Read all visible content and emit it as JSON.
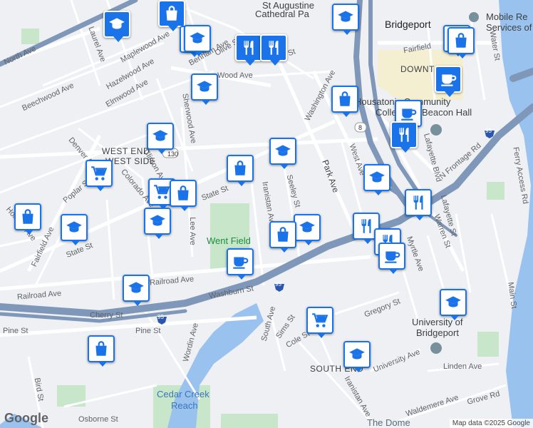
{
  "labels": {
    "north_ave": "North Ave",
    "laurel_ave": "Laurel Ave",
    "maplewood_ave": "Maplewood Ave",
    "benham_ave": "Benham Ave",
    "olive_st": "Olive St",
    "vine_st": "Vine St",
    "hazelwood_ave": "Hazelwood Ave",
    "beechwood_ave": "Beechwood Ave",
    "elmwood_ave": "Elmwood Ave",
    "wood_ave": "Wood Ave",
    "sherwood_ave": "Sherwood Ave",
    "washington_ave": "Washington Ave",
    "west_end": "WEST END",
    "west_side": "WEST SIDE",
    "denver_ave": "Denver Ave",
    "poplar_st": "Poplar St",
    "colorado_ave": "Colorado Ave",
    "clinton_ave": "Clinton Ave",
    "state_st": "State St",
    "state_st2": "State St",
    "iranistan_ave": "Iranistan Ave",
    "seeley_st": "Seeley St",
    "park_ave": "Park Ave",
    "west_ave": "West Ave",
    "went_field": "Went Field",
    "lee_ave": "Lee Ave",
    "fairfield_ave": "Fairfield Ave",
    "fairfield_ave2": "Fairfield Ave",
    "holland_ave": "Holland Ave",
    "railroad_ave": "Railroad Ave",
    "washburn_st": "Washburn St",
    "cherry_st": "Cherry St",
    "pine_st": "Pine St",
    "pine_st2": "Pine St",
    "wordin_ave": "Wordin Ave",
    "south_ave": "South Ave",
    "sims_st": "Sims St",
    "cole_st": "Cole St",
    "gregory_st": "Gregory St",
    "south_end": "SOUTH END",
    "university_ave": "University Ave",
    "iranistan_ave2": "Iranistan Ave",
    "linden_ave": "Linden Ave",
    "waldemere_ave": "Waldemere Ave",
    "grove_rd": "Grove Rd",
    "bird_st": "Bird St",
    "osborne_st": "Osborne St",
    "cedar_creek": "Cedar Creek",
    "reach": "Reach",
    "the_dome": "The Dome",
    "st_augustine": "St Augustine",
    "cathedral": "Cathedral Pa",
    "bridgeport": "Bridgeport",
    "mobile_rescue": "Mobile Re",
    "services_of": "Services of",
    "downtown": "DOWNT",
    "housatonic": "Housatonic Community",
    "college": "College",
    "beacon_hall": "Beacon Hall",
    "lafayette_blvd": "Lafayette Blvd",
    "n_frontage_rd": "N Frontage Rd",
    "ferry_access_rd": "Ferry Access Rd",
    "water_st": "Water St",
    "main_st": "Main St",
    "myrtle_ave": "Myrtle Ave",
    "warren_st": "Warren St",
    "lafayette_st": "Lafayette St",
    "university_of": "University of",
    "bridgeport2": "Bridgeport",
    "route_130": "130",
    "route_8": "8",
    "i95_a": "95",
    "i95_b": "95",
    "i95_c": "95",
    "fairfield_downtown": "Fairfield",
    "google": "Google",
    "map_data": "Map data ©2025 Google"
  },
  "pins": [
    {
      "id": "pin-1",
      "type": "school",
      "style": "dark"
    },
    {
      "id": "pin-2",
      "type": "shopping",
      "style": "dark"
    },
    {
      "id": "pin-3",
      "type": "restaurant",
      "style": "dark"
    },
    {
      "id": "pin-4",
      "type": "restaurant",
      "style": "dark"
    },
    {
      "id": "pin-5",
      "type": "school",
      "style": "light"
    },
    {
      "id": "pin-6",
      "type": "school",
      "style": "light"
    },
    {
      "id": "pin-7",
      "type": "shopping",
      "style": "light"
    },
    {
      "id": "pin-8",
      "type": "shopping",
      "style": "light"
    },
    {
      "id": "pin-9",
      "type": "cafe",
      "style": "dark"
    },
    {
      "id": "pin-10",
      "type": "cafe",
      "style": "light"
    },
    {
      "id": "pin-11",
      "type": "restaurant",
      "style": "dark"
    },
    {
      "id": "pin-12",
      "type": "school",
      "style": "light"
    },
    {
      "id": "pin-13",
      "type": "shopping",
      "style": "light"
    },
    {
      "id": "pin-14",
      "type": "school",
      "style": "light"
    },
    {
      "id": "pin-15",
      "type": "shopping",
      "style": "light"
    },
    {
      "id": "pin-16",
      "type": "grocery",
      "style": "light"
    },
    {
      "id": "pin-17",
      "type": "grocery",
      "style": "light"
    },
    {
      "id": "pin-18",
      "type": "shopping",
      "style": "light"
    },
    {
      "id": "pin-19",
      "type": "school",
      "style": "light"
    },
    {
      "id": "pin-20",
      "type": "shopping",
      "style": "light"
    },
    {
      "id": "pin-21",
      "type": "school",
      "style": "light"
    },
    {
      "id": "pin-22",
      "type": "school",
      "style": "light"
    },
    {
      "id": "pin-23",
      "type": "shopping",
      "style": "light"
    },
    {
      "id": "pin-24",
      "type": "school",
      "style": "light"
    },
    {
      "id": "pin-25",
      "type": "cafe",
      "style": "light"
    },
    {
      "id": "pin-26",
      "type": "restaurant",
      "style": "light"
    },
    {
      "id": "pin-27",
      "type": "restaurant",
      "style": "light"
    },
    {
      "id": "pin-28",
      "type": "restaurant",
      "style": "light"
    },
    {
      "id": "pin-29",
      "type": "school",
      "style": "light"
    },
    {
      "id": "pin-30",
      "type": "school",
      "style": "light"
    },
    {
      "id": "pin-31",
      "type": "grocery",
      "style": "light"
    },
    {
      "id": "pin-32",
      "type": "shopping",
      "style": "light"
    },
    {
      "id": "pin-33",
      "type": "school",
      "style": "light"
    },
    {
      "id": "pin-34",
      "type": "cafe",
      "style": "light"
    },
    {
      "id": "pin-35",
      "type": "restaurant",
      "style": "light"
    },
    {
      "id": "pin-36",
      "type": "school",
      "style": "light"
    }
  ],
  "colors": {
    "pin": "#1a73e8",
    "water": "#9ac2ef",
    "park": "#c8e6c9",
    "highway": "#7f97b8",
    "road": "#ffffff"
  }
}
